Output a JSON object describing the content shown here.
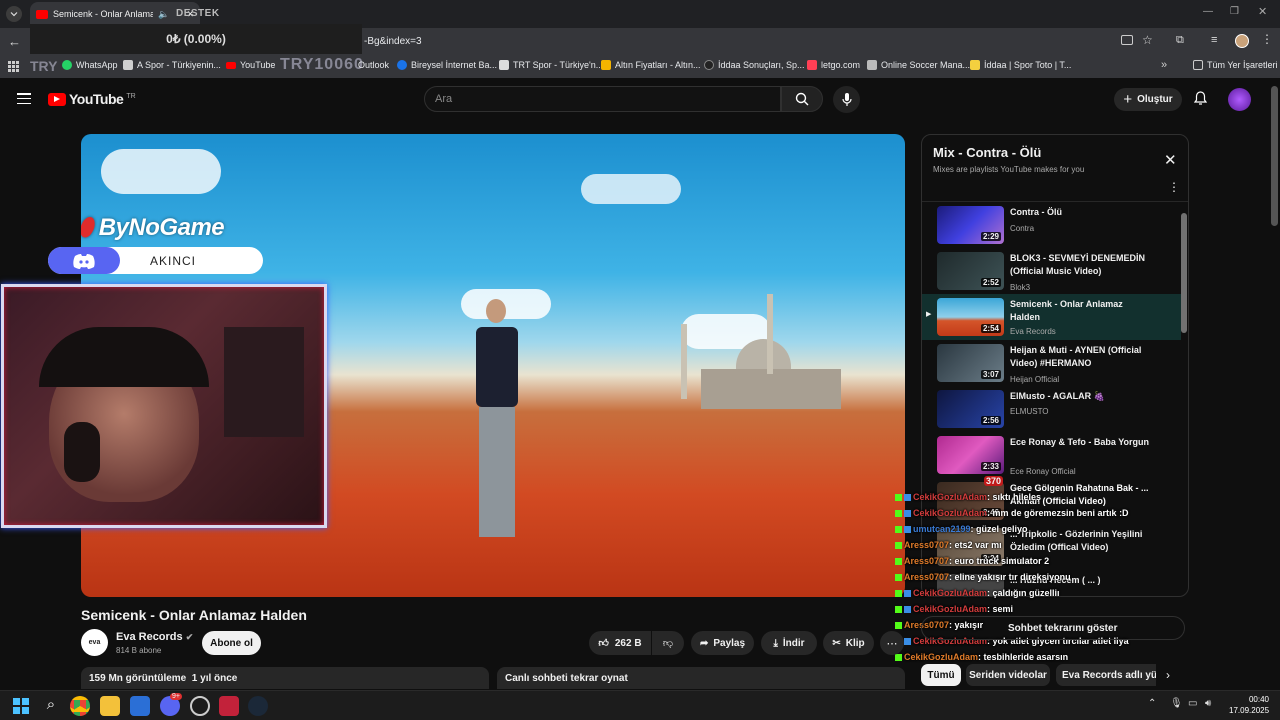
{
  "browser": {
    "tab_title": "Semicenk - Onlar Anlamaz H",
    "overlay_destek": "DESTEK",
    "donation": "0₺ (0.00%)",
    "url_fragment": "-Bg&index=3",
    "overlay_try": "TRY10060",
    "overlay_try_small": "TRY"
  },
  "bookmarks": [
    {
      "label": "WhatsApp",
      "color": "#25d366"
    },
    {
      "label": "A Spor - Türkiyenin...",
      "color": "#cfcfcf"
    },
    {
      "label": "YouTube",
      "color": "#ff0000"
    },
    {
      "label": "Outlook",
      "color": "#0078d4"
    },
    {
      "label": "Bireysel İnternet Ba...",
      "color": "#1a73e8"
    },
    {
      "label": "TRT Spor - Türkiye'n...",
      "color": "#dddddd"
    },
    {
      "label": "Altın Fiyatları - Altın...",
      "color": "#f4b400"
    },
    {
      "label": "İddaa Sonuçları, Sp...",
      "color": "#222222"
    },
    {
      "label": "letgo.com",
      "color": "#ff3f55"
    },
    {
      "label": "Online Soccer Mana...",
      "color": "#bbbbbb"
    },
    {
      "label": "İddaa | Spor Toto | T...",
      "color": "#f4d03f"
    },
    {
      "label": "Tüm Yer İşaretleri",
      "color": "#cccccc"
    }
  ],
  "yt": {
    "logo": "YouTube",
    "region": "TR",
    "search_placeholder": "Ara",
    "create_label": "Oluştur"
  },
  "stream_overlay": {
    "brand": "ByNoGame",
    "discord_name": "AKINCI"
  },
  "video": {
    "title": "Semicenk - Onlar Anlamaz Halden",
    "channel": "Eva Records",
    "channel_avatar_text": "eva",
    "subscribers": "814 B abone",
    "subscribe": "Abone ol",
    "likes": "262 B",
    "share": "Paylaş",
    "download": "İndir",
    "clip": "Klip",
    "views": "159 Mn görüntüleme  1 yıl önce",
    "live_chat_replay": "Canlı sohbeti tekrar oynat"
  },
  "playlist": {
    "title": "Mix - Contra - Ölü",
    "subtitle": "Mixes are playlists YouTube makes for you",
    "items": [
      {
        "title": "Contra - Ölü",
        "channel": "Contra",
        "duration": "2:29",
        "thumb": "#3a3ad0"
      },
      {
        "title": "BLOK3 - SEVMEYİ DENEMEDİN (Official Music Video)",
        "channel": "Blok3",
        "duration": "2:52",
        "thumb": "#2d3a3c"
      },
      {
        "title": "Semicenk - Onlar Anlamaz Halden",
        "channel": "Eva Records",
        "duration": "2:54",
        "thumb": "#3fa6d8"
      },
      {
        "title": "Heijan & Muti - AYNEN (Official Video) #HERMANO",
        "channel": "Heijan Official",
        "duration": "3:07",
        "thumb": "#3d4b55"
      },
      {
        "title": "ElMusto - AGALAR 🍇",
        "channel": "ELMUSTO",
        "duration": "2:56",
        "thumb": "#1b2a6a"
      },
      {
        "title": "Ece Ronay & Tefo - Baba Yorgun",
        "channel": "Ece Ronay Official",
        "duration": "2:33",
        "thumb": "#c93aa6"
      },
      {
        "title": "Gece Gölgenin Rahatına Bak - ... Akman (Official Video)",
        "channel": "",
        "duration": "2:46",
        "thumb": "#4a3a30"
      },
      {
        "title": "... Tripkolic - Gözlerinin Yeşilini Özledim (Offical Video)",
        "channel": "Müzik",
        "duration": "3:24",
        "thumb": "#6b5a4a"
      },
      {
        "title": "... Hüznü Hecem ( ... )",
        "channel": "",
        "duration": "",
        "thumb": "#555555"
      }
    ]
  },
  "chat": [
    {
      "user": "CekikGozluAdam",
      "msg": ": sıktı hileleş",
      "color": "#d23c3c"
    },
    {
      "user": "CekikGozluAdam",
      "msg": ": mm de göremezsin beni artık :D",
      "color": "#d23c3c"
    },
    {
      "user": "umutcan2199",
      "msg": ": güzel geliyo",
      "color": "#3a7bd5"
    },
    {
      "user": "Aress0707",
      "msg": ": ets2 var mı",
      "color": "#e07b2a"
    },
    {
      "user": "Aress0707",
      "msg": ": euro truck simulator 2",
      "color": "#e07b2a"
    },
    {
      "user": "Aress0707",
      "msg": ": eline yakışır tır direksiyonu",
      "color": "#e07b2a"
    },
    {
      "user": "CekikGozluAdam",
      "msg": ": çaldığın güzelliı",
      "color": "#d23c3c"
    },
    {
      "user": "CekikGozluAdam",
      "msg": ": semi",
      "color": "#d23c3c"
    },
    {
      "user": "Aress0707",
      "msg": ": yakışır",
      "color": "#e07b2a"
    },
    {
      "user": "CekikGozluAdam",
      "msg": ": yok atlet giycen tırcılar atlet liya",
      "color": "#d23c3c"
    },
    {
      "user": "Aress0707",
      "msg": ": tesbihleride asarsın",
      "color": "#e07b2a"
    }
  ],
  "chat_badge": "370",
  "show_replay": "Sohbet tekrarını göster",
  "filters": [
    "Tümü",
    "Seriden videolar",
    "Eva Records adlı yükl"
  ],
  "taskbar": {
    "time": "00:40",
    "date": "17.09.2025",
    "badge": "9+"
  }
}
